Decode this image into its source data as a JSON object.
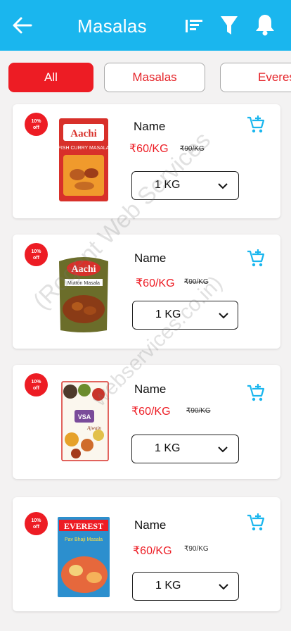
{
  "header": {
    "title": "Masalas",
    "back_icon": "arrow-left-icon",
    "sort_icon": "sort-icon",
    "filter_icon": "filter-icon",
    "notification_icon": "bell-icon",
    "bg_color": "#1ab6ee"
  },
  "categories": [
    {
      "label": "All",
      "active": true
    },
    {
      "label": "Masalas",
      "active": false
    },
    {
      "label": "Everes",
      "active": false
    }
  ],
  "products": [
    {
      "badge_line1": "10%",
      "badge_line2": "off",
      "name": "Name",
      "price": "₹60/KG",
      "old_price": "₹90/KG",
      "quantity": "1 KG",
      "brand": "Aachi",
      "image_caption": "FISH CURRY MASALA"
    },
    {
      "badge_line1": "10%",
      "badge_line2": "off",
      "name": "Name",
      "price": "₹60/KG",
      "old_price": "₹90/KG",
      "quantity": "1 KG",
      "brand": "Aachi",
      "image_caption": "Mutton Masala"
    },
    {
      "badge_line1": "10%",
      "badge_line2": "off",
      "name": "Name",
      "price": "₹60/KG",
      "old_price": "₹90/KG",
      "quantity": "1 KG",
      "brand": "VSA",
      "image_caption": "Ajwain"
    },
    {
      "badge_line1": "10%",
      "badge_line2": "off",
      "name": "Name",
      "price": "₹60/KG",
      "old_price": "₹90/KG",
      "quantity": "1 KG",
      "brand": "EVEREST",
      "image_caption": "Pav Bhaji Masala"
    }
  ],
  "watermark": {
    "line1": "(Rogent Web Services",
    "line2": "webservices.co.in)"
  },
  "colors": {
    "accent": "#ed1c24",
    "cart_icon": "#1ab6ee"
  }
}
